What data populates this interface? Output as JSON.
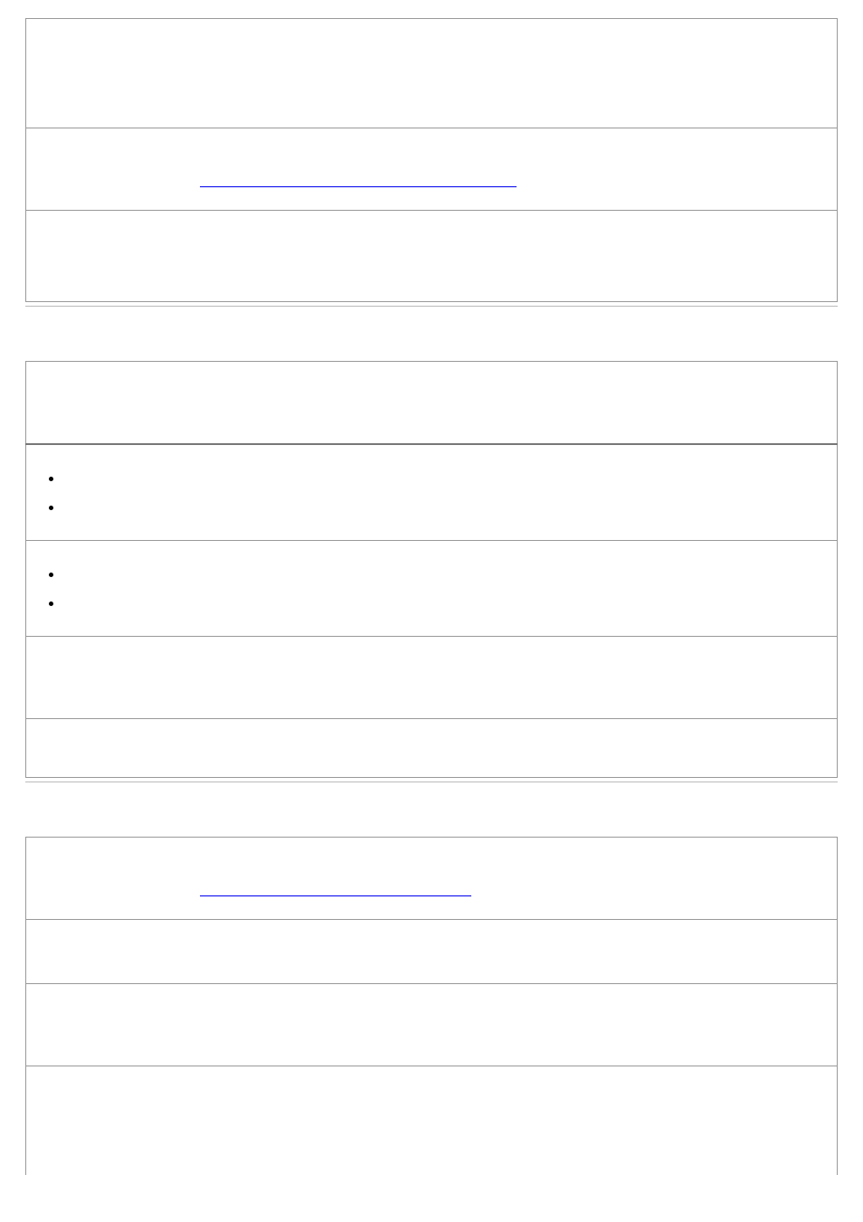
{
  "tables": {
    "t1": {
      "rows": [
        {
          "type": "blank",
          "height": "tall"
        },
        {
          "type": "link",
          "link_text": " "
        },
        {
          "type": "blank",
          "height": "med"
        }
      ]
    },
    "t2": {
      "rows": [
        {
          "type": "header",
          "height": "medsm"
        },
        {
          "type": "bullets",
          "items": [
            "",
            ""
          ]
        },
        {
          "type": "bullets",
          "items": [
            "",
            ""
          ]
        },
        {
          "type": "blank",
          "height": "medsm"
        },
        {
          "type": "blank",
          "height": "shorter"
        }
      ]
    },
    "t3": {
      "rows": [
        {
          "type": "link",
          "link_text": " "
        },
        {
          "type": "blank",
          "height": "short"
        },
        {
          "type": "blank",
          "height": "medsm"
        },
        {
          "type": "blank",
          "height": "tall"
        }
      ]
    }
  }
}
